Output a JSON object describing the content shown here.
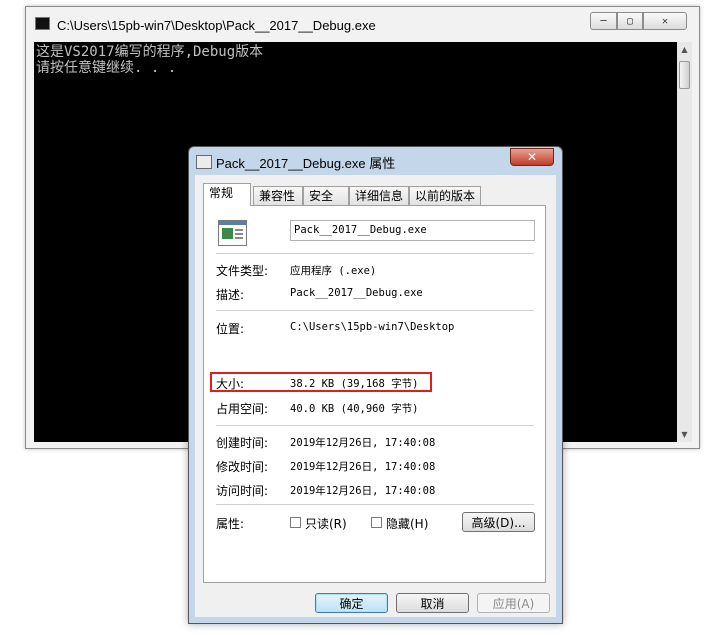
{
  "console": {
    "title": "C:\\Users\\15pb-win7\\Desktop\\Pack__2017__Debug.exe",
    "min_glyph": "─",
    "max_glyph": "▢",
    "close_glyph": "✕",
    "lines": [
      "这是VS2017编写的程序,Debug版本",
      "请按任意键继续. . ."
    ],
    "scroll_up": "▲",
    "scroll_down": "▼"
  },
  "dialog": {
    "title": "Pack__2017__Debug.exe 属性",
    "close_glyph": "✕",
    "tabs": [
      "常规",
      "兼容性",
      "安全",
      "详细信息",
      "以前的版本"
    ],
    "file_name": "Pack__2017__Debug.exe",
    "rows": {
      "type": {
        "label": "文件类型:",
        "value": "应用程序 (.exe)"
      },
      "description": {
        "label": "描述:",
        "value": "Pack__2017__Debug.exe"
      },
      "location": {
        "label": "位置:",
        "value": "C:\\Users\\15pb-win7\\Desktop"
      },
      "size": {
        "label": "大小:",
        "value": "38.2 KB (39,168 字节)"
      },
      "size_on_disk": {
        "label": "占用空间:",
        "value": "40.0 KB (40,960 字节)"
      },
      "created": {
        "label": "创建时间:",
        "value": "2019年12月26日, 17:40:08"
      },
      "modified": {
        "label": "修改时间:",
        "value": "2019年12月26日, 17:40:08"
      },
      "accessed": {
        "label": "访问时间:",
        "value": "2019年12月26日, 17:40:08"
      }
    },
    "attributes": {
      "label": "属性:",
      "readonly": {
        "label": "只读(R)",
        "checked": false
      },
      "hidden": {
        "label": "隐藏(H)",
        "checked": false
      },
      "advanced_label": "高级(D)..."
    },
    "buttons": {
      "ok": "确定",
      "cancel": "取消",
      "apply": "应用(A)"
    },
    "colors": {
      "highlight_box": "#e01e1e",
      "title_bar": "#c4d6ea"
    }
  }
}
